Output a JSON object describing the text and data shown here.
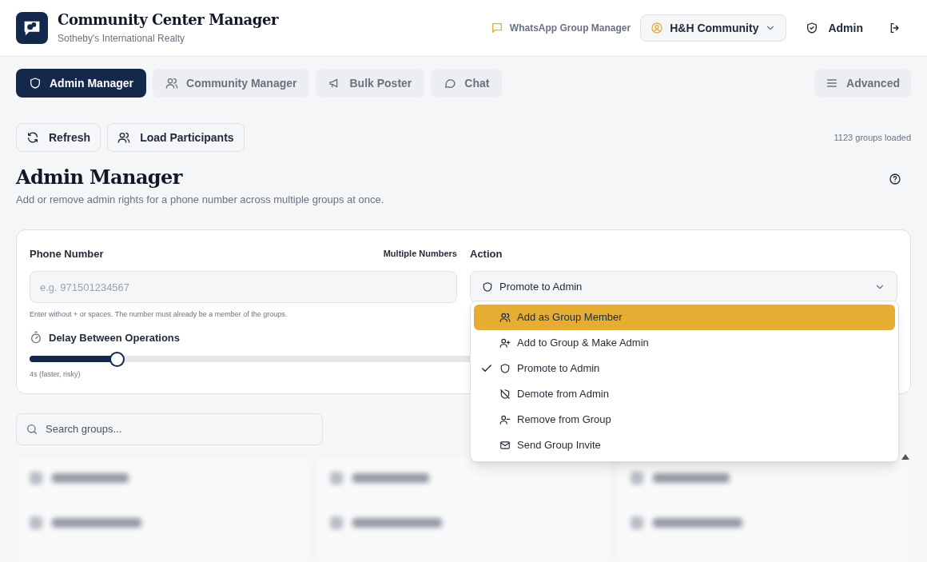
{
  "header": {
    "title": "Community Center Manager",
    "subtitle": "Sotheby's International Realty",
    "app_label": "WhatsApp Group Manager",
    "community": "H&H Community",
    "user": "Admin"
  },
  "tabs": [
    {
      "label": "Admin Manager",
      "selected": true
    },
    {
      "label": "Community Manager",
      "selected": false
    },
    {
      "label": "Bulk Poster",
      "selected": false
    },
    {
      "label": "Chat",
      "selected": false
    }
  ],
  "advanced_button": "Advanced",
  "toolbar": {
    "buttons": [
      {
        "label": "Refresh"
      },
      {
        "label": "Load Participants"
      }
    ],
    "status": "1123 groups loaded"
  },
  "page": {
    "title": "Admin Manager",
    "description": "Add or remove admin rights for a phone number across multiple groups at once."
  },
  "form": {
    "phone_label": "Phone Number",
    "multiple_link": "Multiple Numbers",
    "phone_placeholder": "e.g. 971501234567",
    "phone_hint": "Enter without + or spaces. The number must already be a member of the groups.",
    "delay_label": "Delay Between Operations",
    "delay": {
      "level": 0.1
    },
    "delay_reading": "4s (faster, risky)",
    "action_label": "Action",
    "action_value": "Promote to Admin"
  },
  "action_menu": [
    {
      "label": "Add as Group Member",
      "highlighted": true,
      "selected": false
    },
    {
      "label": "Add to Group & Make Admin",
      "highlighted": false,
      "selected": false
    },
    {
      "label": "Promote to Admin",
      "highlighted": false,
      "selected": true
    },
    {
      "label": "Demote from Admin",
      "highlighted": false,
      "selected": false
    },
    {
      "label": "Remove from Group",
      "highlighted": false,
      "selected": false
    },
    {
      "label": "Send Group Invite",
      "highlighted": false,
      "selected": false
    }
  ],
  "search": {
    "placeholder": "Search groups..."
  }
}
